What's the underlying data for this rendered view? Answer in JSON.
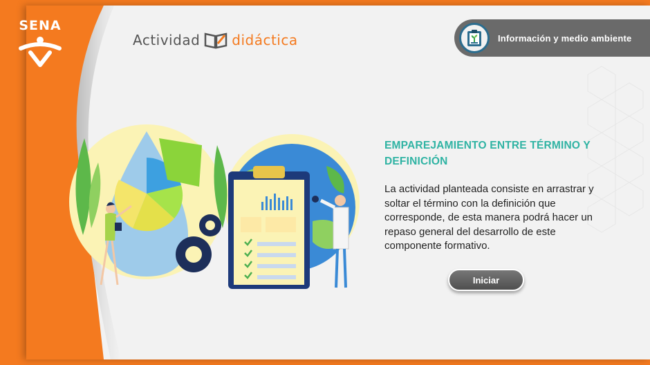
{
  "brand": {
    "org": "SENA",
    "activity_word1": "Actividad",
    "activity_word2": "didáctica"
  },
  "header": {
    "topic": "Información y medio ambiente",
    "topic_icon": "clipboard-plant-icon"
  },
  "content": {
    "title": "EMPAREJAMIENTO ENTRE TÉRMINO Y DEFINICIÓN",
    "description": "La actividad planteada consiste en arrastrar y soltar el término con la definición que corresponde, de esta manera podrá hacer un repaso general del desarrollo de este componente formativo.",
    "start_label": "Iniciar"
  },
  "colors": {
    "frame": "#f47a1f",
    "card": "#f2f2f2",
    "title": "#2fb3a3",
    "pill": "#6a6a6a"
  }
}
